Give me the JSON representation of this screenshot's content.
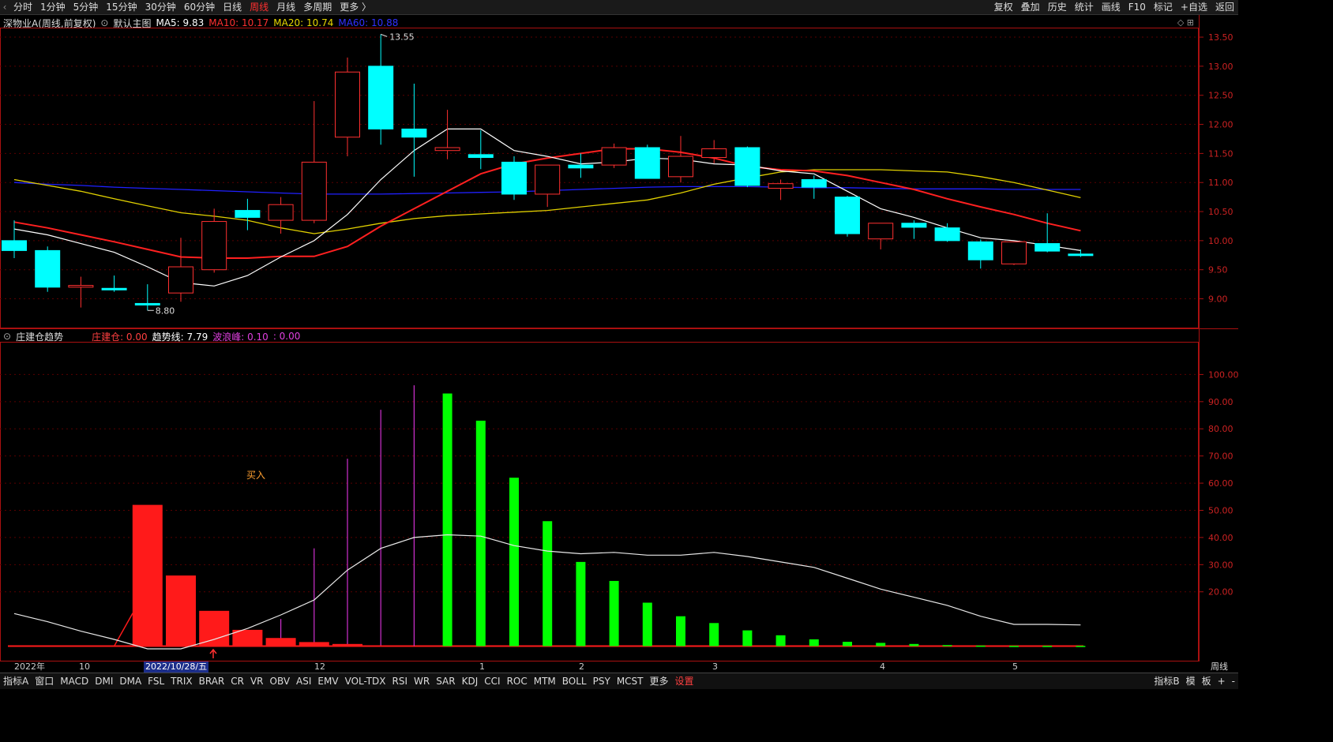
{
  "toolbar": {
    "period_tabs": [
      "分时",
      "1分钟",
      "5分钟",
      "15分钟",
      "30分钟",
      "60分钟",
      "日线",
      "周线",
      "月线",
      "多周期",
      "更多"
    ],
    "active_tab": "周线",
    "right_tools": [
      "复权",
      "叠加",
      "历史",
      "统计",
      "画线",
      "F10",
      "标记",
      "+自选",
      "返回"
    ]
  },
  "main_legend": {
    "stock": "深物业A(周线,前复权)",
    "template": "默认主图",
    "ma5": "MA5: 9.83",
    "ma10": "MA10: 10.17",
    "ma20": "MA20: 10.74",
    "ma60": "MA60: 10.88"
  },
  "sub_legend": {
    "name": "庄建仓趋势",
    "zjc": "庄建仓: 0.00",
    "qsx": "趋势线: 7.79",
    "blf": "波浪峰: 0.10",
    "extra": ": 0.00",
    "signal": "买入"
  },
  "colors": {
    "up": "#ff3030",
    "down": "#00ffff",
    "ma5": "#ffffff",
    "ma10": "#ff2020",
    "ma20": "#e0d000",
    "ma60": "#2020ff",
    "build_bar": "#ff1a1a",
    "release_bar": "#00ff00",
    "wave": "#d030d0",
    "trend": "#e8e8e8",
    "bg": "#000000"
  },
  "xaxis": {
    "labels": [
      "2022年",
      "10",
      "2022/10/28/五",
      "12",
      "1",
      "2",
      "3",
      "4",
      "5"
    ],
    "period": "周线"
  },
  "bottom_tabs": [
    "指标A",
    "窗口",
    "MACD",
    "DMI",
    "DMA",
    "FSL",
    "TRIX",
    "BRAR",
    "CR",
    "VR",
    "OBV",
    "ASI",
    "EMV",
    "VOL-TDX",
    "RSI",
    "WR",
    "SAR",
    "KDJ",
    "CCI",
    "ROC",
    "MTM",
    "BOLL",
    "PSY",
    "MCST",
    "更多",
    "设置"
  ],
  "bottom_right": [
    "指标B",
    "模",
    "板",
    "+",
    "-"
  ],
  "chart_data": [
    {
      "type": "candlestick",
      "title": "深物业A(周线,前复权)",
      "yticks": [
        9.0,
        9.5,
        10.0,
        10.5,
        11.0,
        11.5,
        12.0,
        12.5,
        13.0,
        13.5
      ],
      "ylim": [
        8.6,
        13.65
      ],
      "annotations": [
        {
          "label": "13.55",
          "candle": 11,
          "value": 13.55
        },
        {
          "label": "8.80",
          "candle": 4,
          "value": 8.8
        }
      ],
      "candles": [
        {
          "o": 10.0,
          "c": 9.83,
          "h": 10.35,
          "l": 9.7
        },
        {
          "o": 9.83,
          "c": 9.2,
          "h": 9.9,
          "l": 9.12
        },
        {
          "o": 9.2,
          "c": 9.23,
          "h": 9.38,
          "l": 8.85
        },
        {
          "o": 9.18,
          "c": 9.16,
          "h": 9.4,
          "l": 9.12
        },
        {
          "o": 8.92,
          "c": 8.9,
          "h": 9.25,
          "l": 8.8
        },
        {
          "o": 9.1,
          "c": 9.55,
          "h": 10.05,
          "l": 8.95
        },
        {
          "o": 9.5,
          "c": 10.33,
          "h": 10.55,
          "l": 9.45
        },
        {
          "o": 10.52,
          "c": 10.4,
          "h": 10.72,
          "l": 10.18
        },
        {
          "o": 10.35,
          "c": 10.62,
          "h": 10.75,
          "l": 10.12
        },
        {
          "o": 10.35,
          "c": 11.35,
          "h": 12.4,
          "l": 10.3
        },
        {
          "o": 11.78,
          "c": 12.9,
          "h": 13.15,
          "l": 11.45
        },
        {
          "o": 13.0,
          "c": 11.92,
          "h": 13.55,
          "l": 11.65
        },
        {
          "o": 11.92,
          "c": 11.78,
          "h": 12.7,
          "l": 11.1
        },
        {
          "o": 11.55,
          "c": 11.6,
          "h": 12.25,
          "l": 11.4
        },
        {
          "o": 11.48,
          "c": 11.43,
          "h": 11.9,
          "l": 11.23
        },
        {
          "o": 11.35,
          "c": 10.8,
          "h": 11.45,
          "l": 10.7
        },
        {
          "o": 10.8,
          "c": 11.3,
          "h": 11.3,
          "l": 10.58
        },
        {
          "o": 11.3,
          "c": 11.25,
          "h": 11.5,
          "l": 11.08
        },
        {
          "o": 11.3,
          "c": 11.6,
          "h": 11.67,
          "l": 11.25
        },
        {
          "o": 11.6,
          "c": 11.07,
          "h": 11.65,
          "l": 11.07
        },
        {
          "o": 11.1,
          "c": 11.45,
          "h": 11.8,
          "l": 11.0
        },
        {
          "o": 11.43,
          "c": 11.58,
          "h": 11.73,
          "l": 11.33
        },
        {
          "o": 11.6,
          "c": 10.95,
          "h": 11.62,
          "l": 10.92
        },
        {
          "o": 10.9,
          "c": 10.98,
          "h": 11.05,
          "l": 10.7
        },
        {
          "o": 11.05,
          "c": 10.92,
          "h": 11.12,
          "l": 10.72
        },
        {
          "o": 10.75,
          "c": 10.12,
          "h": 10.77,
          "l": 10.07
        },
        {
          "o": 10.03,
          "c": 10.3,
          "h": 10.3,
          "l": 9.85
        },
        {
          "o": 10.3,
          "c": 10.23,
          "h": 10.35,
          "l": 10.03
        },
        {
          "o": 10.22,
          "c": 10.0,
          "h": 10.3,
          "l": 9.98
        },
        {
          "o": 9.98,
          "c": 9.67,
          "h": 10.02,
          "l": 9.52
        },
        {
          "o": 9.6,
          "c": 9.98,
          "h": 9.98,
          "l": 9.58
        },
        {
          "o": 9.95,
          "c": 9.82,
          "h": 10.47,
          "l": 9.8
        },
        {
          "o": 9.77,
          "c": 9.75,
          "h": 9.85,
          "l": 9.72
        }
      ],
      "series": [
        {
          "name": "MA5",
          "values": [
            10.2,
            10.1,
            9.95,
            9.8,
            9.55,
            9.28,
            9.22,
            9.4,
            9.72,
            10.0,
            10.45,
            11.05,
            11.55,
            11.92,
            11.92,
            11.55,
            11.45,
            11.32,
            11.35,
            11.42,
            11.4,
            11.32,
            11.3,
            11.2,
            11.15,
            10.85,
            10.55,
            10.4,
            10.22,
            10.05,
            10.0,
            9.92,
            9.83
          ]
        },
        {
          "name": "MA10",
          "values": [
            10.32,
            10.22,
            10.1,
            9.98,
            9.85,
            9.72,
            9.7,
            9.7,
            9.73,
            9.73,
            9.9,
            10.25,
            10.55,
            10.85,
            11.15,
            11.32,
            11.42,
            11.5,
            11.58,
            11.58,
            11.52,
            11.42,
            11.28,
            11.22,
            11.2,
            11.12,
            11.0,
            10.88,
            10.72,
            10.58,
            10.45,
            10.3,
            10.17
          ]
        },
        {
          "name": "MA20",
          "values": [
            11.05,
            10.95,
            10.85,
            10.72,
            10.6,
            10.48,
            10.42,
            10.35,
            10.22,
            10.12,
            10.2,
            10.3,
            10.38,
            10.43,
            10.46,
            10.49,
            10.52,
            10.58,
            10.64,
            10.7,
            10.82,
            10.97,
            11.08,
            11.18,
            11.22,
            11.22,
            11.22,
            11.2,
            11.18,
            11.1,
            11.0,
            10.87,
            10.74
          ]
        },
        {
          "name": "MA60",
          "values": [
            11.0,
            10.97,
            10.95,
            10.92,
            10.9,
            10.88,
            10.86,
            10.84,
            10.82,
            10.8,
            10.8,
            10.8,
            10.81,
            10.82,
            10.83,
            10.84,
            10.86,
            10.88,
            10.9,
            10.92,
            10.93,
            10.93,
            10.93,
            10.92,
            10.91,
            10.91,
            10.9,
            10.89,
            10.89,
            10.89,
            10.88,
            10.88,
            10.88
          ]
        }
      ]
    },
    {
      "type": "bar",
      "title": "庄建仓趋势",
      "yticks": [
        20.0,
        30.0,
        40.0,
        50.0,
        60.0,
        70.0,
        80.0,
        90.0,
        100.0
      ],
      "ylim": [
        -1,
        110
      ],
      "series": [
        {
          "name": "庄建仓",
          "color": "red",
          "values": [
            0,
            0,
            0,
            0,
            52,
            26,
            13,
            6,
            3,
            1.5,
            0.8,
            0.3,
            0,
            0,
            0,
            0,
            0,
            0,
            0,
            0,
            0,
            0,
            0,
            0,
            0,
            0,
            0,
            0,
            0,
            0,
            0,
            0,
            0
          ]
        },
        {
          "name": "release",
          "color": "green",
          "values": [
            0,
            0,
            0,
            0,
            0,
            0,
            0,
            0,
            0,
            0,
            0,
            0,
            0,
            93,
            83,
            62,
            46,
            31,
            24,
            16,
            11,
            8.5,
            5.8,
            4,
            2.5,
            1.6,
            1.2,
            0.8,
            0.4,
            0.2,
            0.1,
            0.1,
            0.1
          ]
        },
        {
          "name": "波浪峰",
          "values": [
            0,
            0,
            0,
            0,
            0,
            0,
            0,
            0,
            10,
            36,
            69,
            87,
            96,
            0,
            0,
            0,
            0,
            0,
            0,
            0,
            0,
            0,
            0,
            0,
            0,
            0,
            0,
            0,
            0,
            0,
            0,
            0,
            0
          ]
        },
        {
          "name": "趋势线",
          "values": [
            12,
            9,
            5.5,
            2.5,
            -1,
            -1,
            2.5,
            6.5,
            11.5,
            17,
            28,
            36,
            40,
            41,
            40.5,
            37,
            35,
            34,
            34.5,
            33.5,
            33.5,
            34.5,
            33,
            31,
            29,
            25,
            21,
            18,
            15,
            11,
            8,
            8,
            7.8
          ]
        }
      ]
    }
  ]
}
